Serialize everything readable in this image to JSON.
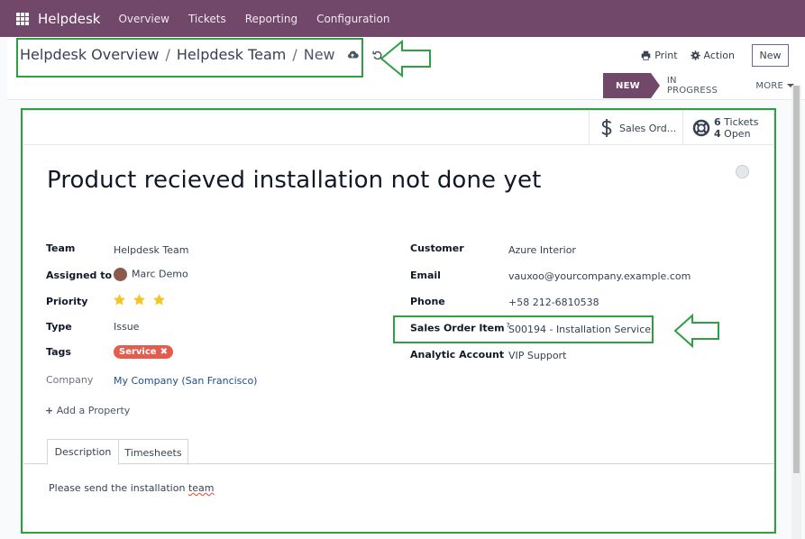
{
  "navbar": {
    "brand": "Helpdesk",
    "items": [
      "Overview",
      "Tickets",
      "Reporting",
      "Configuration"
    ]
  },
  "breadcrumb": {
    "items": [
      "Helpdesk Overview",
      "Helpdesk Team"
    ],
    "current": "New",
    "sep": "/"
  },
  "toolbar": {
    "print": "Print",
    "action": "Action",
    "new": "New"
  },
  "stages": {
    "new": "NEW",
    "in_progress": "IN PROGRESS",
    "more": "MORE"
  },
  "smart_buttons": {
    "sales": "Sales Ord...",
    "tickets_count": "6",
    "tickets_label": "Tickets",
    "open_count": "4",
    "open_label": "Open"
  },
  "ticket": {
    "title": "Product recieved installation not done yet"
  },
  "left_fields": {
    "team_label": "Team",
    "team_value": "Helpdesk Team",
    "assigned_label": "Assigned to",
    "assigned_value": "Marc Demo",
    "priority_label": "Priority",
    "priority_value": 3,
    "type_label": "Type",
    "type_value": "Issue",
    "tags_label": "Tags",
    "tag_value": "Service",
    "company_label": "Company",
    "company_value": "My Company (San Francisco)"
  },
  "right_fields": {
    "customer_label": "Customer",
    "customer_value": "Azure Interior",
    "email_label": "Email",
    "email_value": "vauxoo@yourcompany.example.com",
    "phone_label": "Phone",
    "phone_value": "+58 212-6810538",
    "sol_label": "Sales Order Item",
    "sol_help": "?",
    "sol_value": "S00194 - Installation Service",
    "analytic_label": "Analytic Account",
    "analytic_value": "VIP Support"
  },
  "add_property": "Add a Property",
  "tabs": {
    "description": "Description",
    "timesheets": "Timesheets"
  },
  "description_text": {
    "before": "Please send the installation ",
    "misspelled": "team"
  },
  "colors": {
    "navbar": "#71476a",
    "annotation": "#2ea043",
    "tag": "#e35d4e",
    "star": "#f3c623"
  }
}
